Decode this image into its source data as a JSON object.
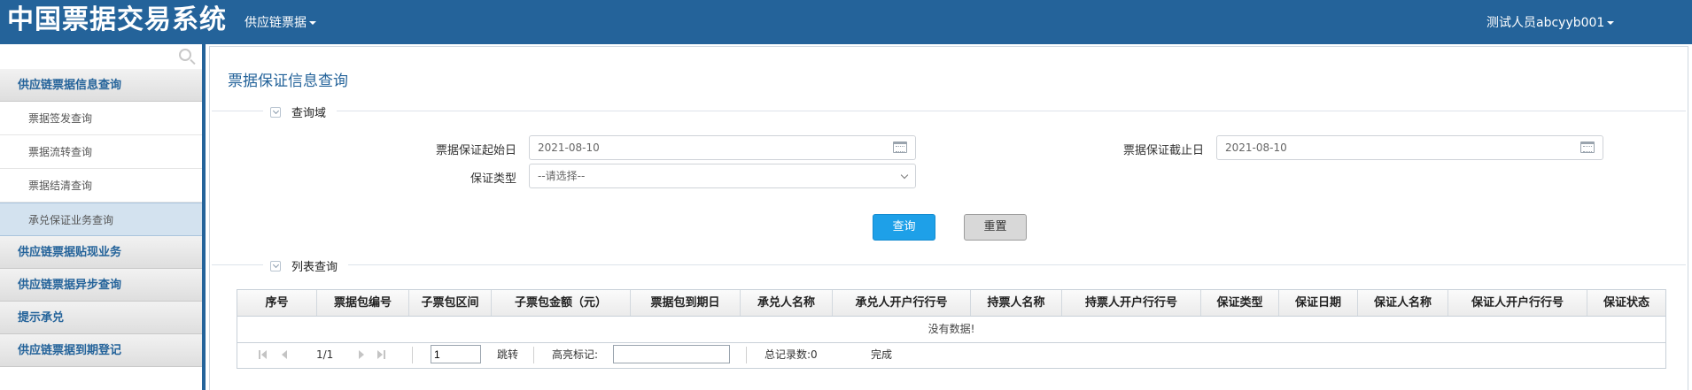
{
  "header": {
    "app_title": "中国票据交易系统",
    "menu_label": "供应链票据",
    "user_label": "测试人员abcyyb001"
  },
  "sidebar": {
    "search_icon": "search-icon",
    "groups": [
      {
        "label": "供应链票据信息查询"
      },
      {
        "label": "供应链票据贴现业务"
      },
      {
        "label": "供应链票据异步查询"
      },
      {
        "label": "提示承兑"
      },
      {
        "label": "供应链票据到期登记"
      }
    ],
    "sub_items": [
      {
        "label": "票据签发查询"
      },
      {
        "label": "票据流转查询"
      },
      {
        "label": "票据结清查询"
      },
      {
        "label": "承兑保证业务查询"
      }
    ]
  },
  "main": {
    "page_title": "票据保证信息查询",
    "query_section_title": "查询域",
    "list_section_title": "列表查询",
    "form": {
      "start_date_label": "票据保证起始日",
      "start_date_value": "2021-08-10",
      "end_date_label": "票据保证截止日",
      "end_date_value": "2021-08-10",
      "type_label": "保证类型",
      "type_placeholder": "--请选择--"
    },
    "buttons": {
      "query": "查询",
      "reset": "重置"
    },
    "table": {
      "columns": [
        "序号",
        "票据包编号",
        "子票包区间",
        "子票包金额（元）",
        "票据包到期日",
        "承兑人名称",
        "承兑人开户行行号",
        "持票人名称",
        "持票人开户行行号",
        "保证类型",
        "保证日期",
        "保证人名称",
        "保证人开户行行号",
        "保证状态"
      ],
      "empty_text": "没有数据!"
    },
    "pager": {
      "page_info": "1/1",
      "page_input": "1",
      "jump_label": "跳转",
      "highlight_label": "高亮标记:",
      "total_label": "总记录数:0",
      "status": "完成"
    }
  }
}
